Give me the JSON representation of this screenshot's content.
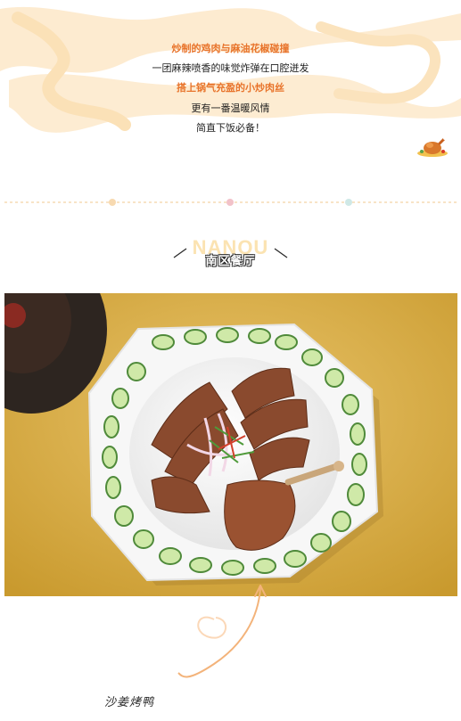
{
  "intro": {
    "line1": "炒制的鸡肉与麻油花椒碰撞",
    "line2": "一团麻辣喷香的味觉炸弹在口腔迸发",
    "line3": "搭上锅气充盈的小炒肉丝",
    "line4": "更有一番温暖风情",
    "line5": "简直下饭必备！"
  },
  "section": {
    "ghost_text": "NANQU",
    "title": "南区餐厅"
  },
  "dish": {
    "caption": "沙姜烤鸭"
  },
  "colors": {
    "accent": "#e8732a",
    "cream": "#fbe6c2"
  },
  "icons": [
    "roast-chicken-icon"
  ]
}
